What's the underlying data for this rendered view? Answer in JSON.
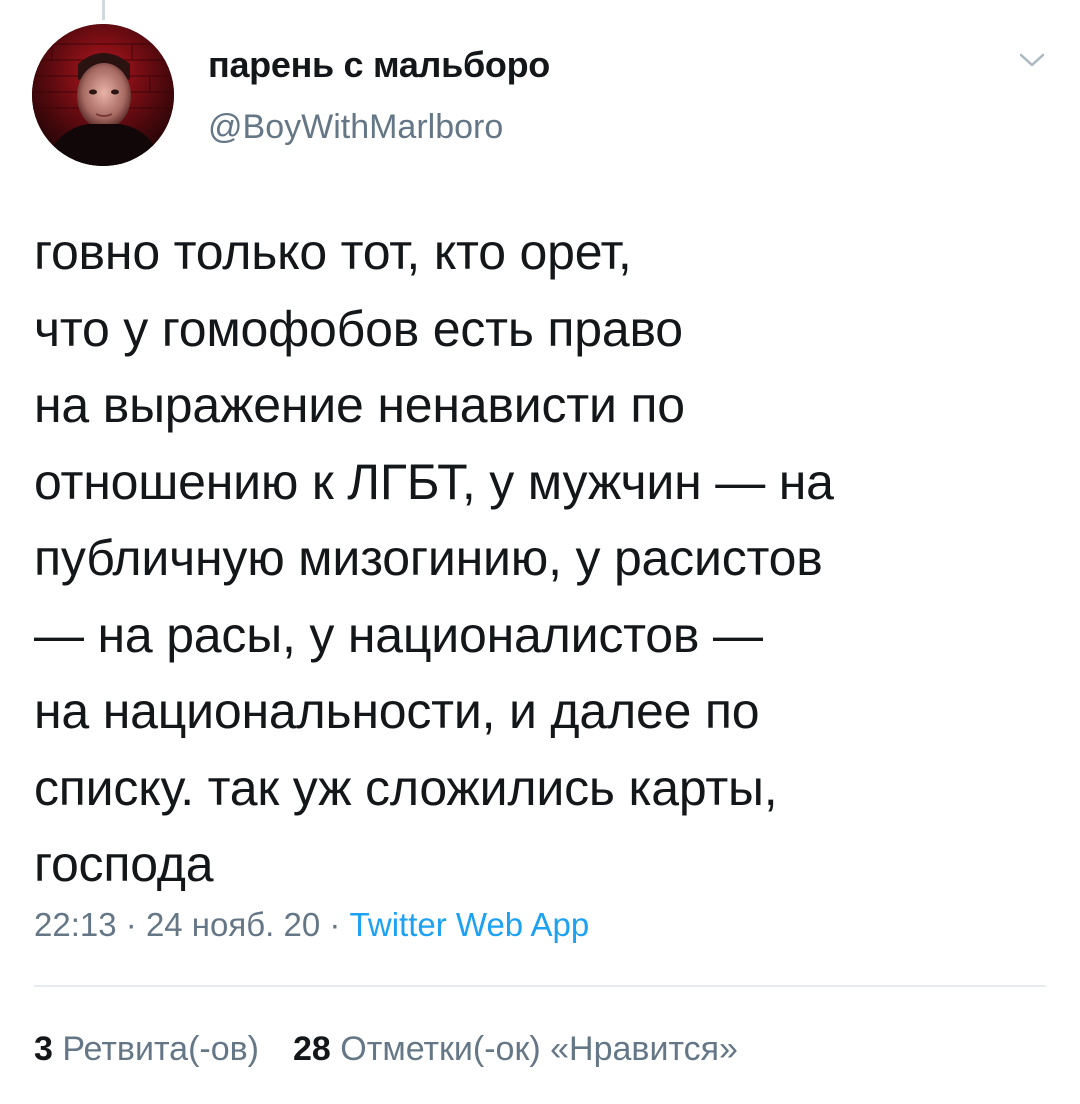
{
  "author": {
    "display_name": "парень с мальборо",
    "handle": "@BoyWithMarlboro"
  },
  "tweet": {
    "text": "говно только тот, кто орет,\nчто у гомофобов есть право\nна выражение ненависти по\nотношению к ЛГБТ, у мужчин — на\nпубличную мизогинию, у расистов\n— на расы, у националистов —\nна национальности, и далее по\nсписку. так уж сложились карты,\nгоспода",
    "time": "22:13",
    "date": "24 нояб. 20",
    "separator": "·",
    "source": "Twitter Web App"
  },
  "stats": {
    "retweets_count": "3",
    "retweets_label": "Ретвита(-ов)",
    "likes_count": "28",
    "likes_label": "Отметки(-ок) «Нравится»"
  },
  "icons": {
    "menu": "chevron-down-icon"
  },
  "colors": {
    "text": "#14171a",
    "secondary": "#657786",
    "accent": "#1da1f2",
    "divider": "#e6ecf0"
  }
}
